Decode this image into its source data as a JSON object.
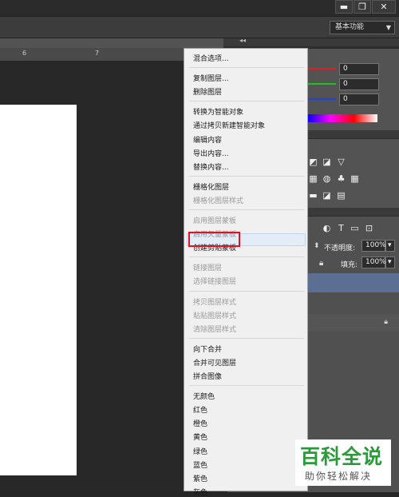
{
  "window": {
    "minimize": "▬",
    "restore": "❐",
    "close": "✕",
    "workspace": "基本功能"
  },
  "ruler": {
    "marks": [
      "6",
      "7"
    ]
  },
  "color_panel": {
    "r_value": "0",
    "g_value": "0",
    "b_value": "0",
    "accent_red": "#e02020",
    "accent_green": "#20c020",
    "accent_blue": "#2040e0"
  },
  "layers_panel": {
    "opacity_label": "不透明度:",
    "opacity_value": "100%",
    "fill_label": "填充:",
    "fill_value": "100%"
  },
  "context_menu": {
    "groups": [
      [
        {
          "label": "混合选项...",
          "disabled": false
        }
      ],
      [
        {
          "label": "复制图层...",
          "disabled": false
        },
        {
          "label": "删除图层",
          "disabled": false
        }
      ],
      [
        {
          "label": "转换为智能对象",
          "disabled": false
        },
        {
          "label": "通过拷贝新建智能对象",
          "disabled": false
        },
        {
          "label": "编辑内容",
          "disabled": false
        },
        {
          "label": "导出内容...",
          "disabled": false
        },
        {
          "label": "替换内容...",
          "disabled": false
        }
      ],
      [
        {
          "label": "栅格化图层",
          "disabled": false
        },
        {
          "label": "栅格化图层样式",
          "disabled": true
        }
      ],
      [
        {
          "label": "启用图层蒙板",
          "disabled": true
        },
        {
          "label": "启用矢量蒙板",
          "disabled": true
        },
        {
          "label": "创建剪贴蒙板",
          "disabled": false
        }
      ],
      [
        {
          "label": "链接图层",
          "disabled": true
        },
        {
          "label": "选择链接图层",
          "disabled": true
        }
      ],
      [
        {
          "label": "拷贝图层样式",
          "disabled": true
        },
        {
          "label": "粘贴图层样式",
          "disabled": true
        },
        {
          "label": "清除图层样式",
          "disabled": true
        }
      ],
      [
        {
          "label": "向下合并",
          "disabled": false
        },
        {
          "label": "合并可见图层",
          "disabled": false
        },
        {
          "label": "拼合图像",
          "disabled": false
        }
      ],
      [
        {
          "label": "无颜色",
          "disabled": false
        },
        {
          "label": "红色",
          "disabled": false
        },
        {
          "label": "橙色",
          "disabled": false
        },
        {
          "label": "黄色",
          "disabled": false
        },
        {
          "label": "绿色",
          "disabled": false
        },
        {
          "label": "蓝色",
          "disabled": false
        },
        {
          "label": "紫色",
          "disabled": false
        },
        {
          "label": "灰色",
          "disabled": false
        }
      ]
    ]
  },
  "watermark": {
    "top": "百科全说",
    "bottom": "助你轻松解决"
  }
}
